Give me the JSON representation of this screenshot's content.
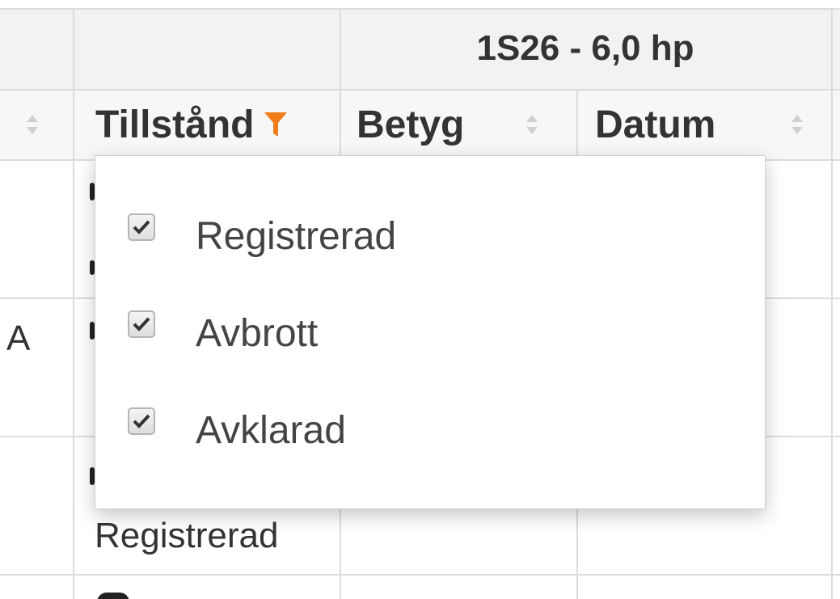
{
  "table": {
    "group_header": "1S26 - 6,0 hp",
    "columns": {
      "tillstand": "Tillstånd",
      "betyg": "Betyg",
      "datum": "Datum"
    },
    "partial_cell_left": "A",
    "row_status_visible": "Registrerad"
  },
  "filter_dropdown": {
    "options": [
      {
        "label": "Registrerad",
        "checked": true
      },
      {
        "label": "Avbrott",
        "checked": true
      },
      {
        "label": "Avklarad",
        "checked": true
      }
    ]
  },
  "colors": {
    "filter_active": "#f07d1a",
    "header_group_bg": "#f2f2f2",
    "header_bg": "#f7f7f7",
    "grid_line": "#dcdcdc",
    "text": "#333333"
  },
  "icons": {
    "filter": "funnel-icon",
    "sort": "sort-arrows-icon",
    "check": "checkmark-icon"
  }
}
